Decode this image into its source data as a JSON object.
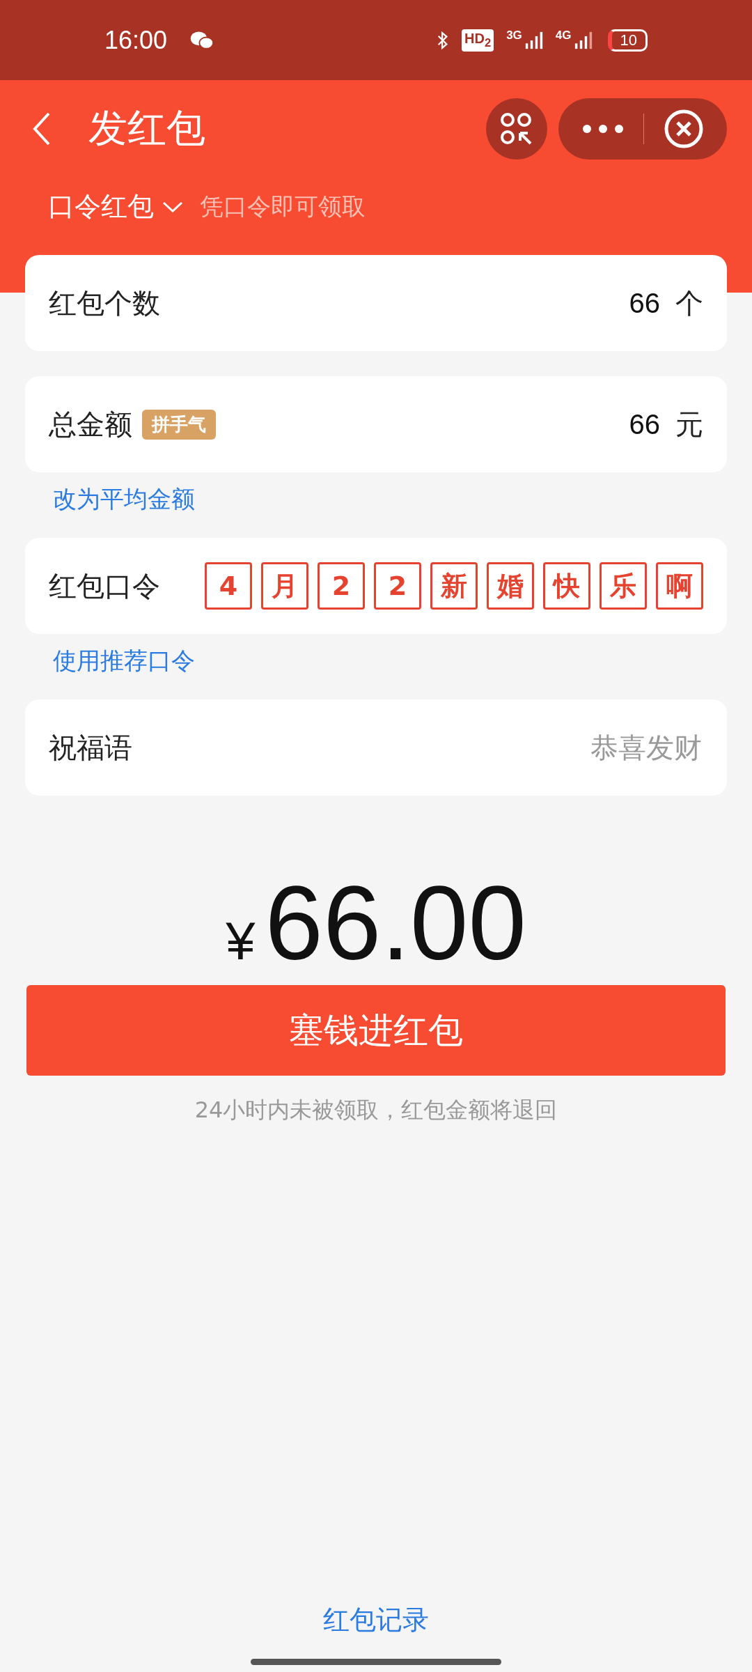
{
  "status_bar": {
    "time": "16:00",
    "hd": "HD$_{2}$",
    "net_1": "3G",
    "net_2": "4G",
    "battery": "10"
  },
  "header": {
    "title": "发红包",
    "type_selector": "口令红包",
    "hint": "凭口令即可领取"
  },
  "form": [
    {
      "kind": "field",
      "label": "红包个数",
      "value": "66",
      "unit": "个"
    },
    {
      "kind": "field",
      "label": "总金额",
      "badge": "拼手气",
      "value": "66",
      "unit": "元"
    },
    {
      "kind": "link",
      "text": "改为平均金额"
    },
    {
      "kind": "password",
      "label": "红包口令",
      "chars": [
        "4",
        "月",
        "2",
        "2",
        "新",
        "婚",
        "快",
        "乐",
        "啊"
      ]
    },
    {
      "kind": "link",
      "text": "使用推荐口令"
    },
    {
      "kind": "input",
      "label": "祝福语",
      "placeholder": "恭喜发财"
    }
  ],
  "total": {
    "currency": "¥",
    "amount": "66.00"
  },
  "submit_button": "塞钱进红包",
  "note": "24小时内未被领取，红包金额将退回",
  "footer_link": "红包记录"
}
